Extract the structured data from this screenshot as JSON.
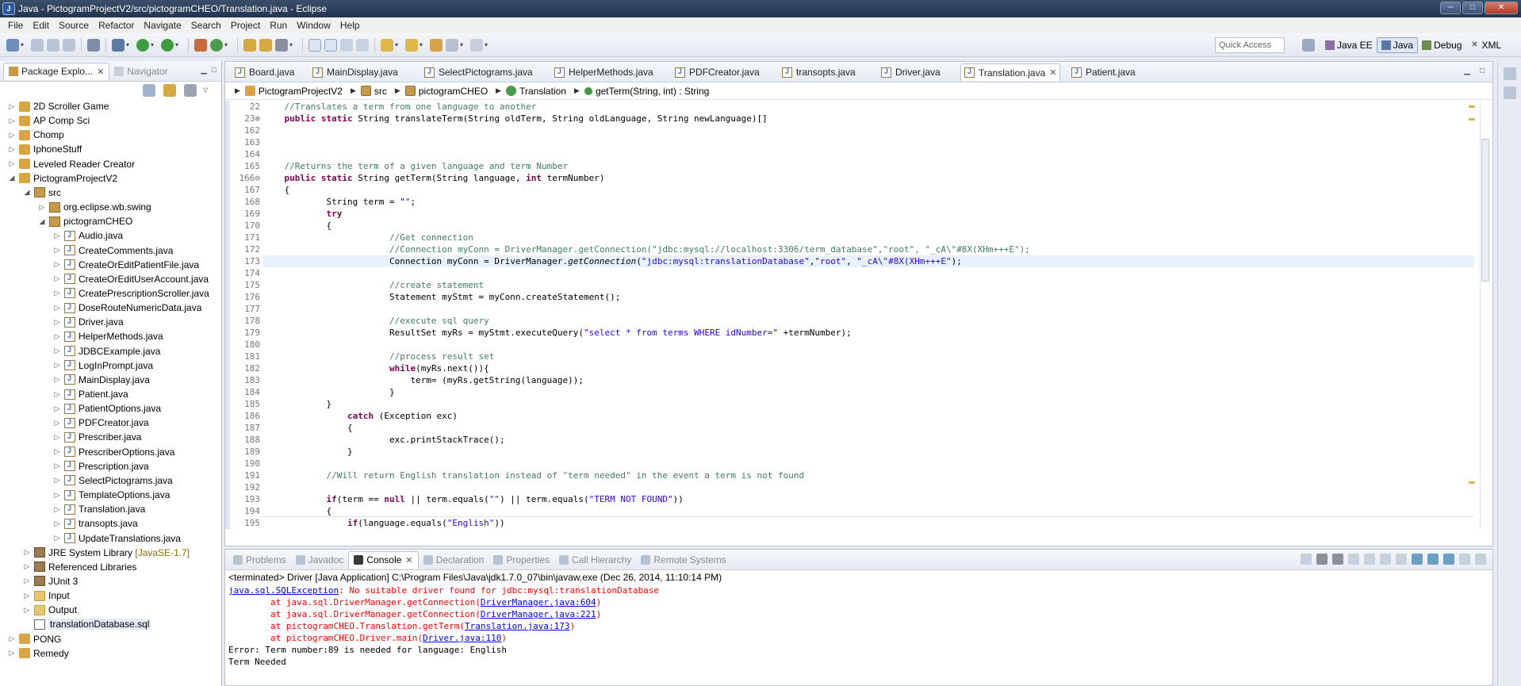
{
  "window": {
    "title": "Java - PictogramProjectV2/src/pictogramCHEO/Translation.java - Eclipse",
    "min": "─",
    "max": "□",
    "close": "✕"
  },
  "menu": [
    "File",
    "Edit",
    "Source",
    "Refactor",
    "Navigate",
    "Search",
    "Project",
    "Run",
    "Window",
    "Help"
  ],
  "quick_access": "Quick Access",
  "perspectives": [
    "Java EE",
    "Java",
    "Debug",
    "XML"
  ],
  "package_explorer": {
    "tab_label": "Package Explo...",
    "navigator_label": "Navigator",
    "tree": [
      {
        "label": "2D Scroller Game",
        "depth": 0,
        "icon": "proj",
        "expand": "▷"
      },
      {
        "label": "AP Comp Sci",
        "depth": 0,
        "icon": "proj",
        "expand": "▷"
      },
      {
        "label": "Chomp",
        "depth": 0,
        "icon": "proj",
        "expand": "▷"
      },
      {
        "label": "IphoneStuff",
        "depth": 0,
        "icon": "proj",
        "expand": "▷"
      },
      {
        "label": "Leveled Reader Creator",
        "depth": 0,
        "icon": "proj",
        "expand": "▷"
      },
      {
        "label": "PictogramProjectV2",
        "depth": 0,
        "icon": "proj",
        "expand": "◢"
      },
      {
        "label": "src",
        "depth": 1,
        "icon": "pkg",
        "expand": "◢"
      },
      {
        "label": "org.eclipse.wb.swing",
        "depth": 2,
        "icon": "pkg",
        "expand": "▷"
      },
      {
        "label": "pictogramCHEO",
        "depth": 2,
        "icon": "pkg",
        "expand": "◢"
      },
      {
        "label": "Audio.java",
        "depth": 3,
        "icon": "java",
        "expand": "▷"
      },
      {
        "label": "CreateComments.java",
        "depth": 3,
        "icon": "java",
        "expand": "▷"
      },
      {
        "label": "CreateOrEditPatientFile.java",
        "depth": 3,
        "icon": "java",
        "expand": "▷"
      },
      {
        "label": "CreateOrEditUserAccount.java",
        "depth": 3,
        "icon": "java",
        "expand": "▷"
      },
      {
        "label": "CreatePrescriptionScroller.java",
        "depth": 3,
        "icon": "java",
        "expand": "▷"
      },
      {
        "label": "DoseRouteNumericData.java",
        "depth": 3,
        "icon": "java",
        "expand": "▷"
      },
      {
        "label": "Driver.java",
        "depth": 3,
        "icon": "java",
        "expand": "▷"
      },
      {
        "label": "HelperMethods.java",
        "depth": 3,
        "icon": "java",
        "expand": "▷"
      },
      {
        "label": "JDBCExample.java",
        "depth": 3,
        "icon": "java",
        "expand": "▷"
      },
      {
        "label": "LogInPrompt.java",
        "depth": 3,
        "icon": "java",
        "expand": "▷"
      },
      {
        "label": "MainDisplay.java",
        "depth": 3,
        "icon": "java",
        "expand": "▷"
      },
      {
        "label": "Patient.java",
        "depth": 3,
        "icon": "java",
        "expand": "▷"
      },
      {
        "label": "PatientOptions.java",
        "depth": 3,
        "icon": "java",
        "expand": "▷"
      },
      {
        "label": "PDFCreator.java",
        "depth": 3,
        "icon": "java",
        "expand": "▷"
      },
      {
        "label": "Prescriber.java",
        "depth": 3,
        "icon": "java",
        "expand": "▷"
      },
      {
        "label": "PrescriberOptions.java",
        "depth": 3,
        "icon": "java",
        "expand": "▷"
      },
      {
        "label": "Prescription.java",
        "depth": 3,
        "icon": "java",
        "expand": "▷"
      },
      {
        "label": "SelectPictograms.java",
        "depth": 3,
        "icon": "java",
        "expand": "▷"
      },
      {
        "label": "TemplateOptions.java",
        "depth": 3,
        "icon": "java",
        "expand": "▷"
      },
      {
        "label": "Translation.java",
        "depth": 3,
        "icon": "java",
        "expand": "▷"
      },
      {
        "label": "transopts.java",
        "depth": 3,
        "icon": "java",
        "expand": "▷"
      },
      {
        "label": "UpdateTranslations.java",
        "depth": 3,
        "icon": "java",
        "expand": "▷"
      },
      {
        "label": "JRE System Library",
        "depth": 1,
        "icon": "lib",
        "expand": "▷",
        "suffix": " [JavaSE-1.7]"
      },
      {
        "label": "Referenced Libraries",
        "depth": 1,
        "icon": "lib",
        "expand": "▷"
      },
      {
        "label": "JUnit 3",
        "depth": 1,
        "icon": "lib",
        "expand": "▷"
      },
      {
        "label": "Input",
        "depth": 1,
        "icon": "folder",
        "expand": "▷"
      },
      {
        "label": "Output",
        "depth": 1,
        "icon": "folder",
        "expand": "▷"
      },
      {
        "label": "translationDatabase.sql",
        "depth": 1,
        "icon": "sql",
        "expand": "",
        "selected": true
      },
      {
        "label": "PONG",
        "depth": 0,
        "icon": "proj",
        "expand": "▷"
      },
      {
        "label": "Remedy",
        "depth": 0,
        "icon": "proj",
        "expand": "▷"
      }
    ]
  },
  "editor": {
    "tabs": [
      "Board.java",
      "MainDisplay.java",
      "SelectPictograms.java",
      "HelperMethods.java",
      "PDFCreator.java",
      "transopts.java",
      "Driver.java",
      "Translation.java",
      "Patient.java"
    ],
    "active_tab": "Translation.java",
    "breadcrumb": [
      "PictogramProjectV2",
      "src",
      "pictogramCHEO",
      "Translation",
      "getTerm(String, int) : String"
    ],
    "line_numbers": [
      "22",
      "23⊕",
      "162",
      "163",
      "164",
      "165",
      "166⊖",
      "167",
      "168",
      "169",
      "170",
      "171",
      "172",
      "173",
      "174",
      "175",
      "176",
      "177",
      "178",
      "179",
      "180",
      "181",
      "182",
      "183",
      "184",
      "185",
      "186",
      "187",
      "188",
      "189",
      "190",
      "191",
      "192",
      "193",
      "194",
      "195"
    ],
    "current_line": "173"
  },
  "bottom_panel": {
    "tabs": [
      "Problems",
      "Javadoc",
      "Console",
      "Declaration",
      "Properties",
      "Call Hierarchy",
      "Remote Systems"
    ],
    "active_tab": "Console",
    "status": "<terminated> Driver [Java Application] C:\\Program Files\\Java\\jdk1.7.0_07\\bin\\javaw.exe (Dec 26, 2014, 11:10:14 PM)",
    "lines": {
      "l1_link": "java.sql.SQLException",
      "l1_msg": ": No suitable driver found for jdbc:mysql:translationDatabase",
      "l2_pre": "\tat java.sql.DriverManager.getConnection(",
      "l2_link": "DriverManager.java:604",
      "l3_pre": "\tat java.sql.DriverManager.getConnection(",
      "l3_link": "DriverManager.java:221",
      "l4_pre": "\tat pictogramCHEO.Translation.getTerm(",
      "l4_link": "Translation.java:173",
      "l5_pre": "\tat pictogramCHEO.Driver.main(",
      "l5_link": "Driver.java:110",
      "paren": ")",
      "l6": "Error: Term number:89 is needed for language: English",
      "l7": "Term Needed"
    }
  },
  "code": {
    "c22": "//Translates a term from one language to another",
    "c23_kw": "public static",
    "c23_rest": " String translateTerm(String oldTerm, String oldLanguage, String newLanguage)",
    "c23_box": "[]",
    "c165": "//Returns the term of a given language and term Number",
    "c166_kw": "public static",
    "c166_a": " String getTerm(String language, ",
    "c166_int": "int",
    "c166_b": " termNumber)",
    "brace_open": "{",
    "brace_close": "}",
    "c168_a": "String term = ",
    "c168_s": "\"\"",
    "c168_b": ";",
    "c169": "try",
    "c171": "//Get connection",
    "c172": "//Connection myConn = DriverManager.getConnection(\"jdbc:mysql://localhost:3306/term_database\",\"root\", \"_cA\\\"#8X(XHm+++E\");",
    "c173_a": "Connection myConn = DriverManager.",
    "c173_it": "getConnection",
    "c173_b": "(",
    "c173_s1": "\"jdbc:mysql:translationDatabase\"",
    "c173_c": ",",
    "c173_s2": "\"root\"",
    "c173_d": ", ",
    "c173_s3": "\"_cA\\\"#8X(XHm+++E\"",
    "c173_e": ");",
    "c175": "//create statement",
    "c176": "Statement myStmt = myConn.createStatement();",
    "c178": "//execute sql query",
    "c179_a": "ResultSet myRs = myStmt.executeQuery(",
    "c179_s": "\"select * from terms WHERE idNumber=\"",
    "c179_b": " +termNumber);",
    "c181": "//process result set",
    "c182_kw": "while",
    "c182_rest": "(myRs.next()){",
    "c183": "term= (myRs.getString(language));",
    "c186_kw": "catch",
    "c186_rest": " (Exception exc)",
    "c188": "exc.printStackTrace();",
    "c191": "//Will return English translation instead of \"term needed\" in the event a term is not found",
    "c193_kw1": "if",
    "c193_a": "(term == ",
    "c193_kw2": "null",
    "c193_b": " || term.equals(",
    "c193_s1": "\"\"",
    "c193_c": ") || term.equals(",
    "c193_s2": "\"TERM NOT FOUND\"",
    "c193_d": "))",
    "c195_kw": "if",
    "c195_a": "(language.equals(",
    "c195_s": "\"English\"",
    "c195_b": "))"
  }
}
